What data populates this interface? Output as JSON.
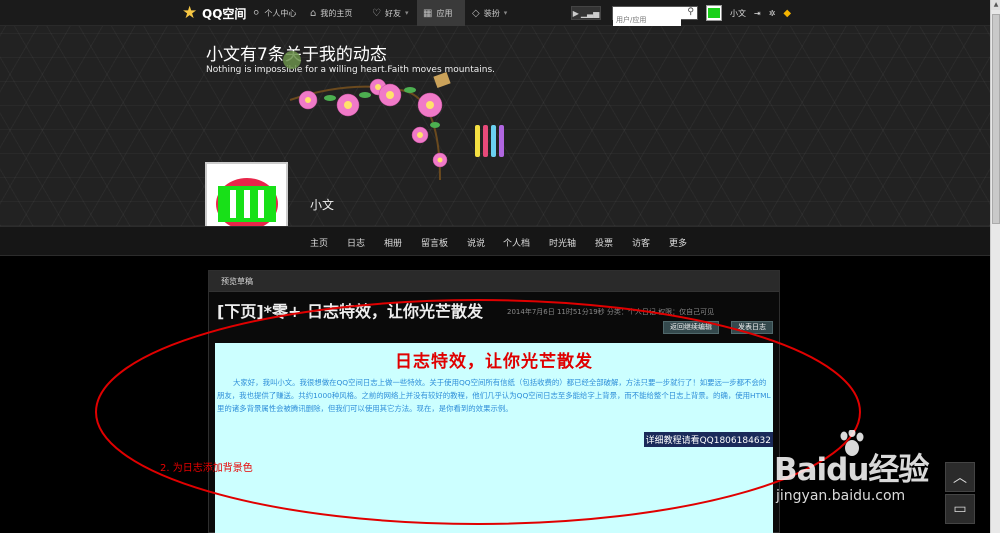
{
  "topnav": {
    "logo_text": "QQ空间",
    "items": [
      {
        "label": "个人中心",
        "icon": "user-icon"
      },
      {
        "label": "我的主页",
        "icon": "home-icon"
      },
      {
        "label": "好友",
        "icon": "friends-icon"
      },
      {
        "label": "应用",
        "icon": "grid-icon"
      },
      {
        "label": "装扮",
        "icon": "shirt-icon"
      }
    ],
    "search_placeholder": "用户/应用",
    "user_name": "小文"
  },
  "header": {
    "title": "小文有7条关于我的动态",
    "motto": "Nothing is impossible for a willing heart.Faith moves mountains.",
    "username": "小文"
  },
  "profile_nav": [
    "主页",
    "日志",
    "相册",
    "留言板",
    "说说",
    "个人档",
    "时光轴",
    "投票",
    "访客",
    "更多"
  ],
  "panel": {
    "header": "预览草稿",
    "post_title": "[下页]*零+   日志特效，让你光芒散发",
    "post_meta": "2014年7月6日 11时51分19秒  分类：个人日记  权限：仅自己可见",
    "btn_back": "返回继续编辑",
    "btn_publish": "发表日志",
    "content_heading": "日志特效，让你光芒散发",
    "content_body": "大家好，我叫小文。我很想做在QQ空间日志上做一些特效。关于使用QQ空间所有信纸（包括收费的）都已经全部破解，方法只要一步就行了！如要远一步都不会的朋友，我也提供了赚送。共约1000种风格。之前的网络上并没有较好的教程，他们几乎认为QQ空间日志至多能给字上背景，而不能给整个日志上背景。的确，使用HTML里的诸多背景属性会被腾讯删除，但我们可以使用其它方法。现在，是你看到的效果示例。",
    "tutorial_link": "详细教程请看QQ1806184632"
  },
  "annotation": "2. 为日志添加背景色",
  "watermark": {
    "brand": "Baidu经验",
    "url": "jingyan.baidu.com"
  },
  "colors": {
    "accent_red": "#e00000",
    "content_bg": "#ccffff",
    "content_text": "#2f8fd9"
  }
}
